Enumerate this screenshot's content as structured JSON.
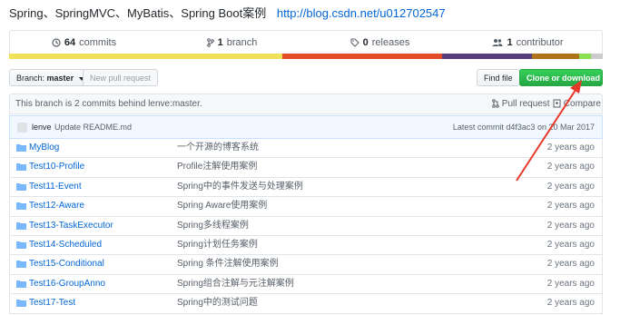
{
  "repo": {
    "description": "Spring、SpringMVC、MyBatis、Spring Boot案例",
    "homepage": "http://blog.csdn.net/u012702547"
  },
  "stats": {
    "commits_count": "64",
    "commits_label": "commits",
    "branch_count": "1",
    "branch_label": "branch",
    "releases_count": "0",
    "releases_label": "releases",
    "contributors_count": "1",
    "contributors_label": "contributor"
  },
  "languages": [
    {
      "color": "#f1e05a",
      "percent": 46
    },
    {
      "color": "#e34c26",
      "percent": 27
    },
    {
      "color": "#563d7c",
      "percent": 15
    },
    {
      "color": "#b07219",
      "percent": 8
    },
    {
      "color": "#89e051",
      "percent": 2
    },
    {
      "color": "#cccccc",
      "percent": 2
    }
  ],
  "toolbar": {
    "branch_label": "Branch:",
    "branch_value": "master",
    "new_pr": "New pull request",
    "find_file": "Find file",
    "clone": "Clone or download"
  },
  "behind": {
    "message": "This branch is 2 commits behind lenve:master.",
    "pull_request": "Pull request",
    "compare": "Compare"
  },
  "commit": {
    "author": "lenve",
    "message": "Update README.md",
    "latest_label": "Latest commit",
    "sha": "d4f3ac3",
    "date": "on 20 Mar 2017"
  },
  "files": [
    {
      "name": "MyBlog",
      "message": "一个开源的博客系统",
      "age": "2 years ago"
    },
    {
      "name": "Test10-Profile",
      "message": "Profile注解使用案例",
      "age": "2 years ago"
    },
    {
      "name": "Test11-Event",
      "message": "Spring中的事件发送与处理案例",
      "age": "2 years ago"
    },
    {
      "name": "Test12-Aware",
      "message": "Spring Aware使用案例",
      "age": "2 years ago"
    },
    {
      "name": "Test13-TaskExecutor",
      "message": "Spring多线程案例",
      "age": "2 years ago"
    },
    {
      "name": "Test14-Scheduled",
      "message": "Spring计划任务案例",
      "age": "2 years ago"
    },
    {
      "name": "Test15-Conditional",
      "message": "Spring 条件注解使用案例",
      "age": "2 years ago"
    },
    {
      "name": "Test16-GroupAnno",
      "message": "Spring组合注解与元注解案例",
      "age": "2 years ago"
    },
    {
      "name": "Test17-Test",
      "message": "Spring中的测试问题",
      "age": "2 years ago"
    }
  ],
  "annotation": {
    "arrow_color": "#e8382a"
  }
}
